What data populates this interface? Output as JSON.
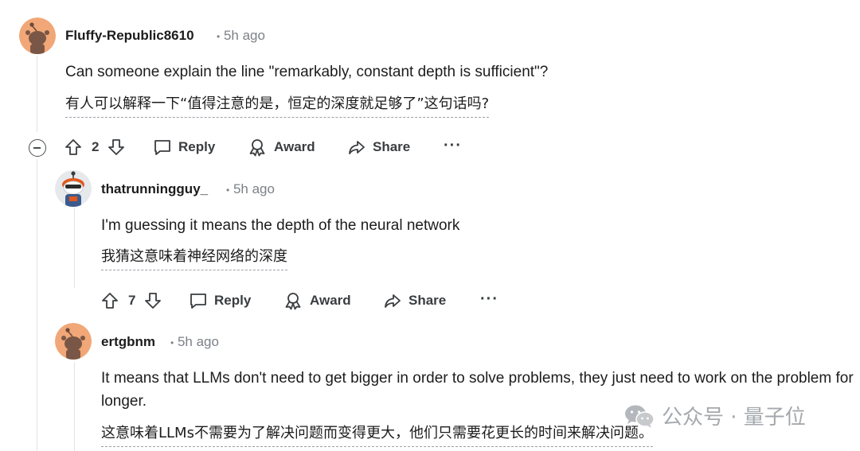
{
  "comments": [
    {
      "author": "Fluffy-Republic8610",
      "time": "5h ago",
      "text_en": "Can someone explain the line \"remarkably, constant depth is sufficient\"?",
      "text_zh": "有人可以解释一下“值得注意的是，恒定的深度就足够了”这句话吗?",
      "votes": "2",
      "colors": {
        "avatar_bg": "#f1a777"
      }
    },
    {
      "author": "thatrunningguy_",
      "time": "5h ago",
      "text_en": "I'm guessing it means the depth of the neural network",
      "text_zh": "我猜这意味着神经网络的深度",
      "votes": "7",
      "colors": {
        "avatar_bg": "#e6e9ec"
      }
    },
    {
      "author": "ertgbnm",
      "time": "5h ago",
      "text_en": "It means that LLMs don't need to get bigger in order to solve problems, they just need to work on the problem for longer.",
      "text_zh": "这意味着LLMs不需要为了解决问题而变得更大，他们只需要花更长的时间来解决问题。",
      "colors": {
        "avatar_bg": "#f1a777"
      }
    }
  ],
  "actions": {
    "reply": "Reply",
    "award": "Award",
    "share": "Share",
    "more": "···"
  },
  "meta_separator": "•",
  "watermark": {
    "text": "公众号 · 量子位",
    "icon": "wechat-icon"
  },
  "icons": {
    "upvote": "arrow-up-icon",
    "downvote": "arrow-down-icon",
    "reply": "speech-bubble-icon",
    "award": "award-ribbon-icon",
    "share": "share-arrow-icon",
    "collapse": "minus-circle-icon",
    "avatar": "snoo-avatar-icon"
  }
}
